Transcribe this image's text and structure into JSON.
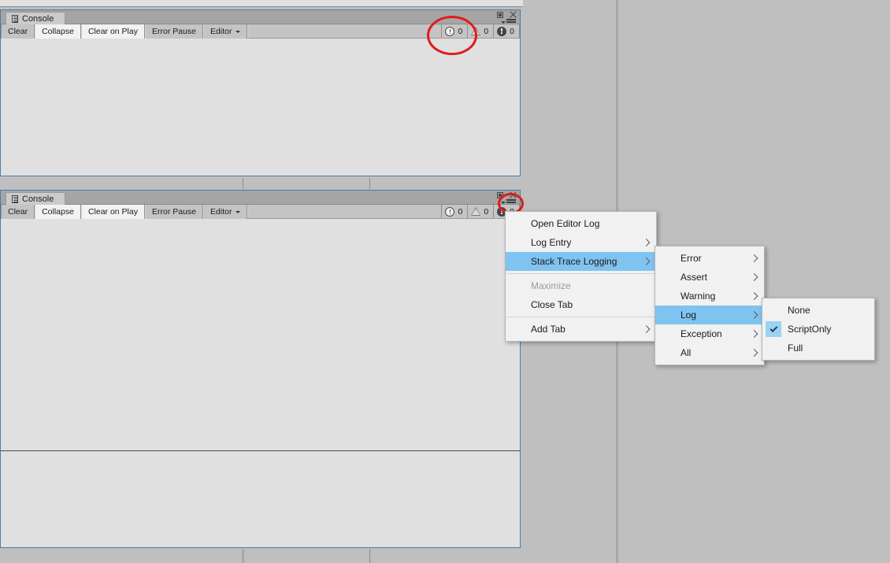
{
  "app": {
    "window_title": "Console"
  },
  "console_top": {
    "tab_label": "Console",
    "tab_icon": "console-document-icon",
    "window_controls": {
      "maximize_icon": "maximize-icon",
      "close_icon": "close-icon",
      "menu_icon": "hamburger-menu-icon",
      "caret_icon": "caret-down-icon"
    },
    "toolbar": {
      "clear_label": "Clear",
      "collapse_label": "Collapse",
      "clear_on_play_label": "Clear on Play",
      "error_pause_label": "Error Pause",
      "editor_label": "Editor"
    },
    "counters": {
      "error_count": "0",
      "warning_count": "0",
      "info_count": "0",
      "error_icon": "error-icon",
      "warning_icon": "warning-icon",
      "info_icon": "info-icon"
    }
  },
  "console_bottom": {
    "tab_label": "Console",
    "tab_icon": "console-document-icon",
    "window_controls": {
      "maximize_icon": "maximize-icon",
      "close_icon": "close-icon",
      "menu_icon": "hamburger-menu-icon",
      "caret_icon": "caret-down-icon"
    },
    "toolbar": {
      "clear_label": "Clear",
      "collapse_label": "Collapse",
      "clear_on_play_label": "Clear on Play",
      "error_pause_label": "Error Pause",
      "editor_label": "Editor"
    },
    "counters": {
      "error_count": "0",
      "warning_count": "0",
      "info_count": "0",
      "error_icon": "error-icon",
      "warning_icon": "warning-icon",
      "info_icon": "info-icon"
    }
  },
  "context_menu": {
    "items": [
      {
        "label": "Open Editor Log",
        "submenu": false,
        "selected": false,
        "disabled": false,
        "separator_after": false
      },
      {
        "label": "Log Entry",
        "submenu": true,
        "selected": false,
        "disabled": false,
        "separator_after": false
      },
      {
        "label": "Stack Trace Logging",
        "submenu": true,
        "selected": true,
        "disabled": false,
        "separator_after": true
      },
      {
        "label": "Maximize",
        "submenu": false,
        "selected": false,
        "disabled": true,
        "separator_after": false
      },
      {
        "label": "Close Tab",
        "submenu": false,
        "selected": false,
        "disabled": false,
        "separator_after": true
      },
      {
        "label": "Add Tab",
        "submenu": true,
        "selected": false,
        "disabled": false,
        "separator_after": false
      }
    ]
  },
  "submenu_stack_trace": {
    "items": [
      {
        "label": "Error",
        "submenu": true,
        "selected": false
      },
      {
        "label": "Assert",
        "submenu": true,
        "selected": false
      },
      {
        "label": "Warning",
        "submenu": true,
        "selected": false
      },
      {
        "label": "Log",
        "submenu": true,
        "selected": true
      },
      {
        "label": "Exception",
        "submenu": true,
        "selected": false
      },
      {
        "label": "All",
        "submenu": true,
        "selected": false
      }
    ]
  },
  "submenu_log": {
    "items": [
      {
        "label": "None",
        "checked": false
      },
      {
        "label": "ScriptOnly",
        "checked": true
      },
      {
        "label": "Full",
        "checked": false
      }
    ]
  },
  "annotations": {
    "highlight_color": "#e01b1b",
    "highlight_top_target": "error-counter-highlight",
    "highlight_bottom_target": "hamburger-menu-highlight"
  },
  "colors": {
    "menu_selection": "#7fc3f0",
    "panel_border": "#3f7fb5",
    "panel_background": "#e0e0e0",
    "toolbar_background": "#bdbdbd",
    "editor_background": "#bfbfbf"
  }
}
